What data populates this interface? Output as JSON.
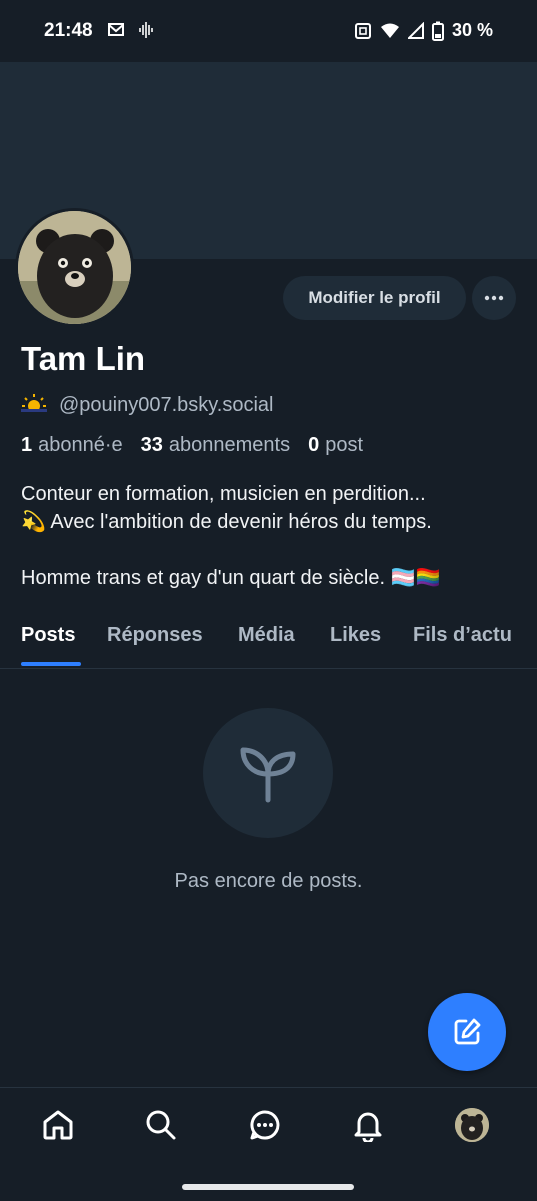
{
  "status_bar": {
    "time": "21:48",
    "battery": "30 %",
    "left_icons": [
      "mail-icon",
      "voice-icon"
    ],
    "right_icons": [
      "nfc-icon",
      "wifi-icon",
      "signal-icon",
      "battery-icon"
    ]
  },
  "profile": {
    "edit_button": "Modifier le profil",
    "more_button_icon": "more-icon",
    "display_name": "Tam Lin",
    "handle_emoji": "🌥️",
    "handle": "@pouiny007.bsky.social",
    "followers_count": "1",
    "followers_label": "abonné·e",
    "following_count": "33",
    "following_label": "abonnements",
    "posts_count": "0",
    "posts_label": "post",
    "bio_line1": "Conteur en formation, musicien en perdition...",
    "bio_line2": "💫 Avec l'ambition de devenir héros du temps.",
    "bio_line3": "Homme trans et gay d'un quart de siècle. 🏳️‍⚧️🏳️‍🌈"
  },
  "tabs": [
    {
      "label": "Posts",
      "active": true
    },
    {
      "label": "Réponses",
      "active": false
    },
    {
      "label": "Média",
      "active": false
    },
    {
      "label": "Likes",
      "active": false
    },
    {
      "label": "Fils d’actu",
      "active": false
    }
  ],
  "empty_state": {
    "icon": "sprout-icon",
    "text": "Pas encore de posts."
  },
  "fab": {
    "icon": "compose-icon"
  },
  "bottom_nav": [
    "home-icon",
    "search-icon",
    "chat-icon",
    "bell-icon",
    "profile-avatar"
  ],
  "colors": {
    "background": "#161e27",
    "banner": "#1f2c38",
    "accent": "#2e7fff",
    "muted_text": "#aeb9c5"
  }
}
